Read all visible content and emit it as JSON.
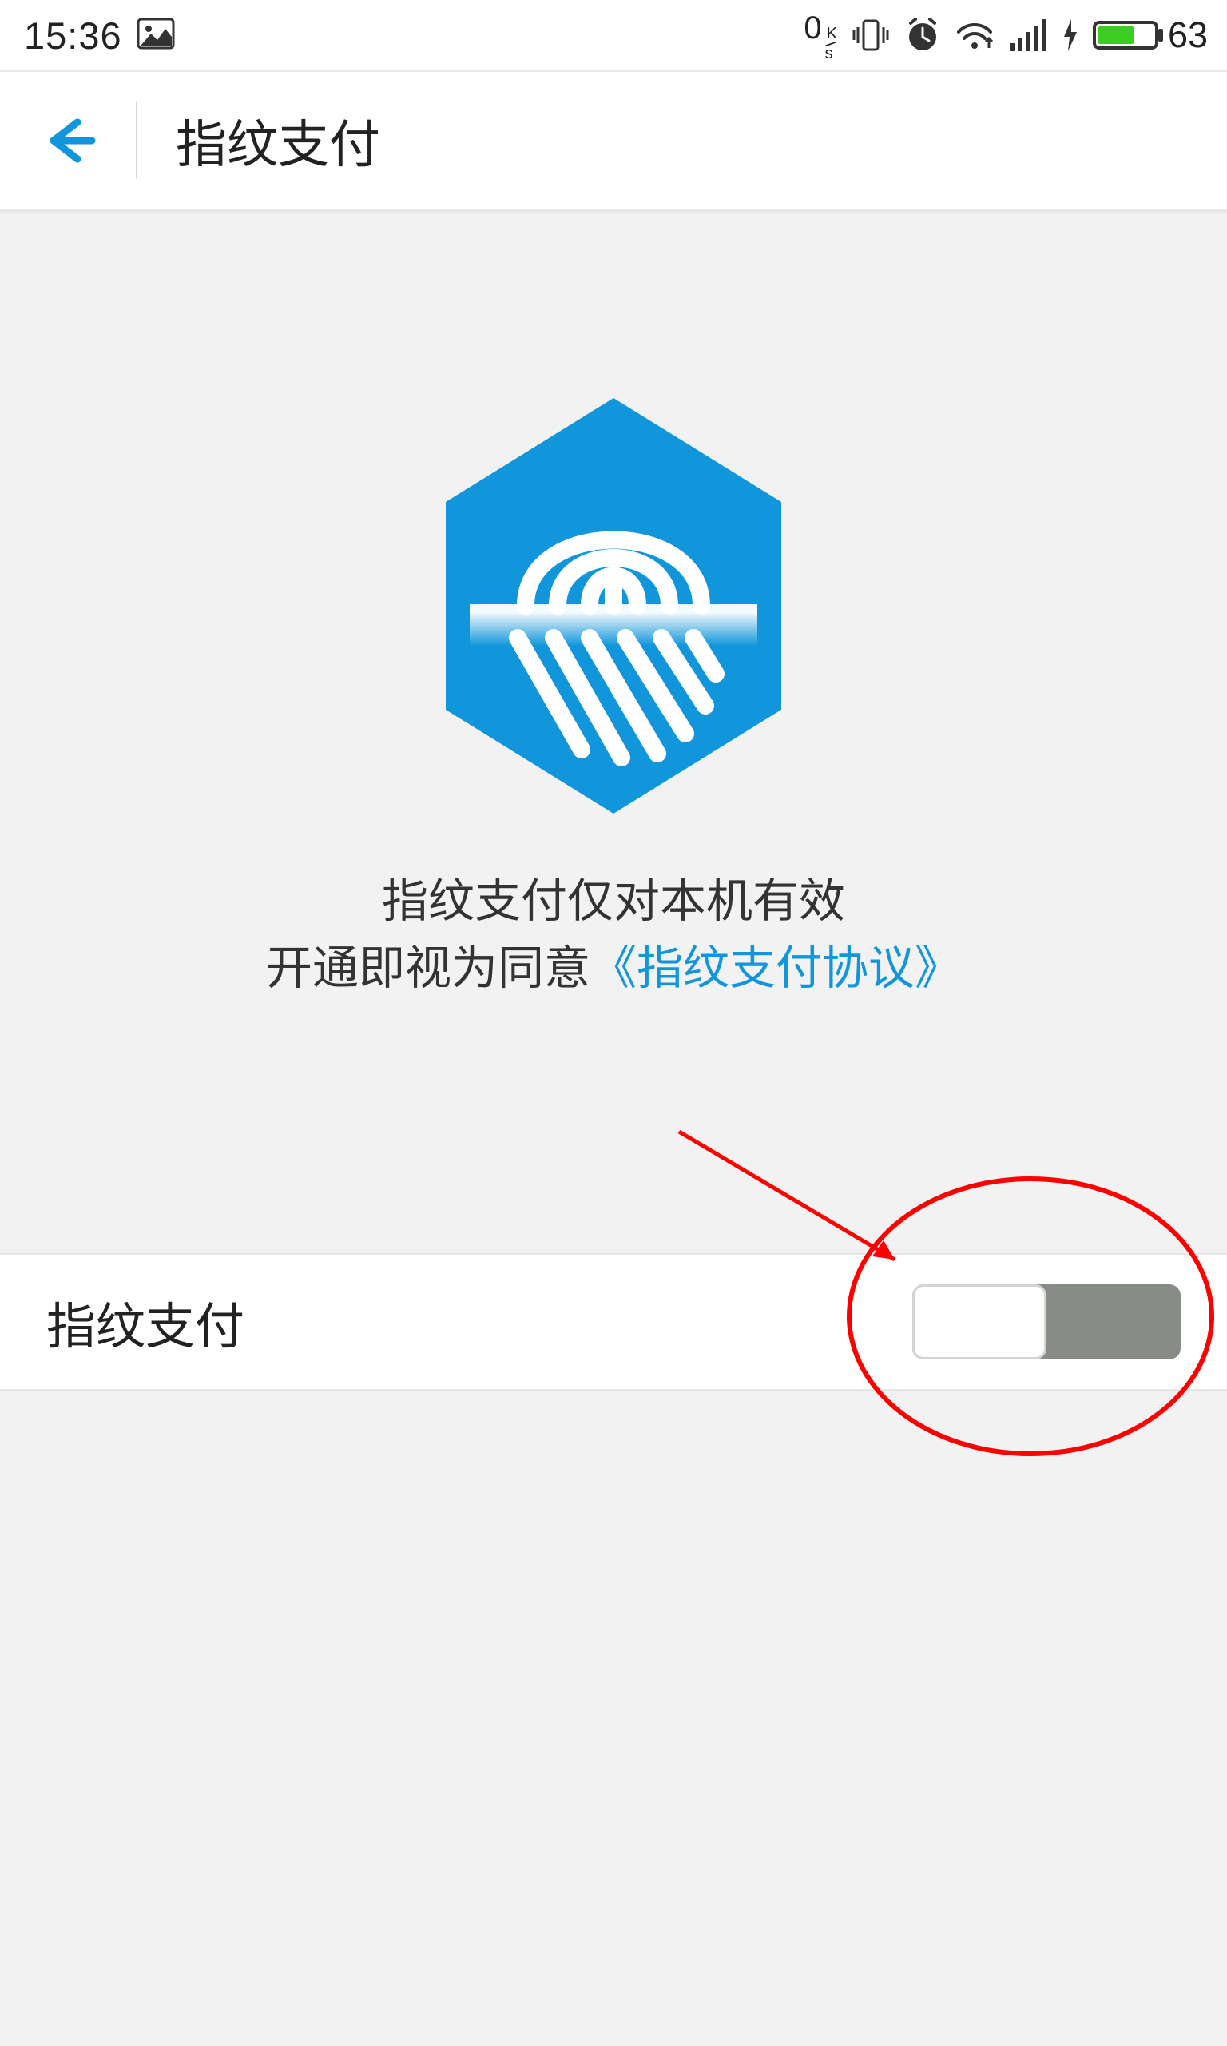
{
  "status": {
    "time": "15:36",
    "net_rate_num": "0",
    "net_rate_unit_top": "K",
    "net_rate_unit_bot": "s",
    "battery_value": "63"
  },
  "header": {
    "title": "指纹支付"
  },
  "hero": {
    "line1": "指纹支付仅对本机有效",
    "line2_pre": "开通即视为同意",
    "line2_link": "《指纹支付协议》"
  },
  "row": {
    "label": "指纹支付",
    "toggle_on": false
  },
  "colors": {
    "accent": "#1296db",
    "link": "#1296db",
    "toggle_track": "#888c87"
  }
}
